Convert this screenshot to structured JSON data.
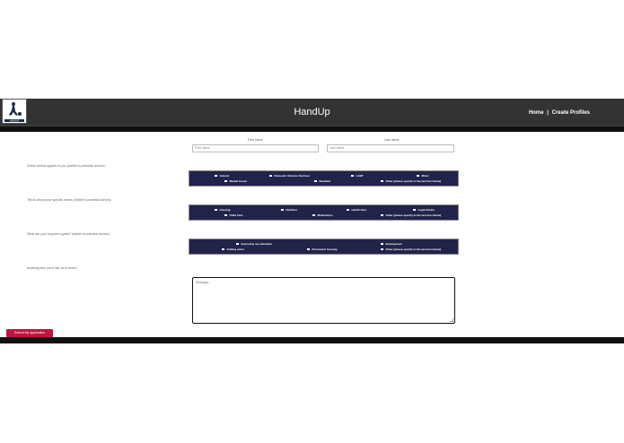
{
  "header": {
    "app_title": "HandUp",
    "nav": {
      "home": "Home",
      "separator": "|",
      "create_profiles": "Create Profiles"
    },
    "logo_text": "HANDUP"
  },
  "name_fields": {
    "first": {
      "label": "First name",
      "placeholder": "First name"
    },
    "last": {
      "label": "Last name",
      "placeholder": "Last name"
    }
  },
  "questions": {
    "applies": "Check all that applies to you (visible to potential donors):",
    "needs": "Tell us about your specific needs (visible to potential donors):",
    "goals": "What are your long term goals? (visible to potential donors):",
    "anything_else": "Anything else you'd like us to know?"
  },
  "applies_options": [
    "Veteran",
    "Domestic Violence Survivor",
    "LGBT",
    "Minor",
    "Mental Issues",
    "Disabled",
    "Other (please specify in the last box below)"
  ],
  "needs_options": [
    "Housing",
    "Nutrition",
    "Health Care",
    "Legal Advice",
    "Child Care",
    "Medications",
    "Other (please specify in the last box below)"
  ],
  "goals_options": [
    "Improving my education",
    "Employment",
    "Getting sober",
    "Permanent housing",
    "Other (please specify in the last box below)"
  ],
  "message": {
    "placeholder": "Message..."
  },
  "submit_label": "Submit My Application",
  "colors": {
    "topbar": "#333333",
    "panel": "#22234a",
    "submit": "#c0143c"
  }
}
